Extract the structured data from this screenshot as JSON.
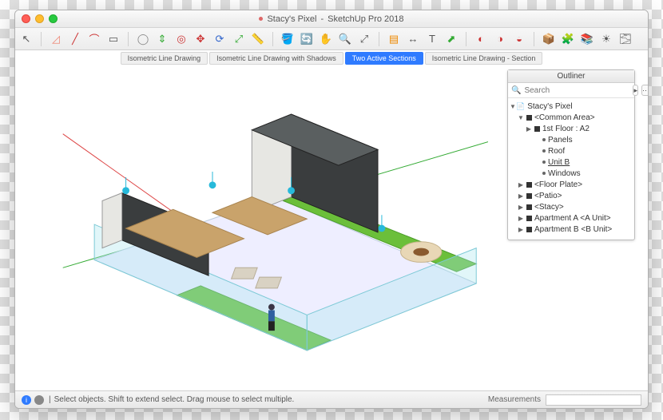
{
  "window": {
    "document": "Stacy's Pixel",
    "app": "SketchUp Pro 2018",
    "title_sep": " - "
  },
  "toolbar": {
    "tools": [
      "select-arrow",
      "eraser",
      "line",
      "arc",
      "rectangle",
      "circle",
      "pushpull",
      "offset",
      "move",
      "rotate",
      "scale",
      "tape",
      "paint",
      "orbit",
      "pan",
      "zoom",
      "zoom-extents",
      "section",
      "dimension",
      "text",
      "axes",
      "walk",
      "look",
      "position",
      "3dwarehouse",
      "extension",
      "layers",
      "shadows",
      "fog"
    ],
    "glyphs": [
      "↖",
      "◿",
      "╱",
      "⌒",
      "▭",
      "◯",
      "⇕",
      "◎",
      "✥",
      "⟳",
      "⤢",
      "📏",
      "🪣",
      "🔄",
      "✋",
      "🔍",
      "⤢",
      "▤",
      "↔",
      "T",
      "⬈",
      "◐",
      "◑",
      "◒",
      "📦",
      "🧩",
      "📚",
      "☀",
      "🌫"
    ]
  },
  "tabs": {
    "items": [
      {
        "label": "Isometric Line Drawing"
      },
      {
        "label": "Isometric Line Drawing with Shadows"
      },
      {
        "label": "Two Active Sections",
        "active": true
      },
      {
        "label": "Isometric Line Drawing - Section"
      }
    ]
  },
  "outliner": {
    "title": "Outliner",
    "search_placeholder": "Search",
    "tree": [
      {
        "indent": 0,
        "expand": "▼",
        "icon": "file",
        "label": "Stacy's Pixel"
      },
      {
        "indent": 1,
        "expand": "▼",
        "icon": "sq",
        "label": "<Common Area>"
      },
      {
        "indent": 2,
        "expand": "▶",
        "icon": "sq",
        "label": "1st Floor : A2"
      },
      {
        "indent": 2,
        "expand": "",
        "icon": "dot",
        "label": "Panels"
      },
      {
        "indent": 2,
        "expand": "",
        "icon": "dot",
        "label": "Roof"
      },
      {
        "indent": 2,
        "expand": "",
        "icon": "dot",
        "label": "Unit B",
        "sel": true
      },
      {
        "indent": 2,
        "expand": "",
        "icon": "dot",
        "label": "Windows"
      },
      {
        "indent": 1,
        "expand": "▶",
        "icon": "sq",
        "label": "<Floor Plate>"
      },
      {
        "indent": 1,
        "expand": "▶",
        "icon": "sq",
        "label": "<Patio>"
      },
      {
        "indent": 1,
        "expand": "▶",
        "icon": "sq",
        "label": "<Stacy>"
      },
      {
        "indent": 1,
        "expand": "▶",
        "icon": "sq",
        "label": "Apartment A <A Unit>"
      },
      {
        "indent": 1,
        "expand": "▶",
        "icon": "sq",
        "label": "Apartment B <B Unit>"
      }
    ]
  },
  "status": {
    "hint": "Select objects. Shift to extend select. Drag mouse to select multiple.",
    "measurements_label": "Measurements"
  },
  "colors": {
    "accent": "#2f7bff",
    "grass": "#6bbf3a",
    "wall_dark": "#3a3d3e",
    "wood": "#c9a36b",
    "glass": "#a9e4ee"
  }
}
